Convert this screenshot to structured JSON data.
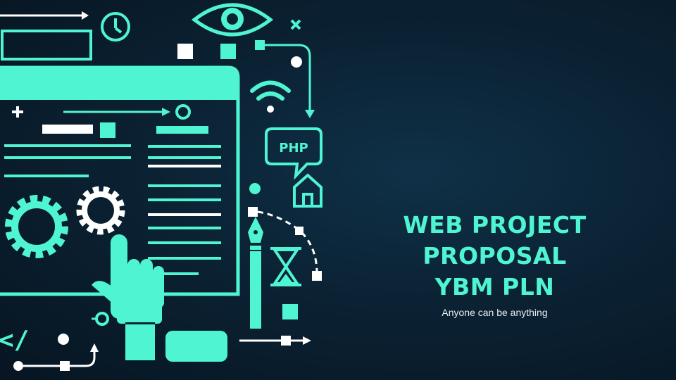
{
  "colors": {
    "accent": "#4ff5d2",
    "white": "#ffffff",
    "background": "#0b2234"
  },
  "slide": {
    "title_lines": [
      "WEB PROJECT",
      "PROPOSAL",
      "YBM PLN"
    ],
    "subtitle": "Anyone can be anything"
  },
  "illustration": {
    "php_label": "PHP",
    "code_label": "</"
  }
}
